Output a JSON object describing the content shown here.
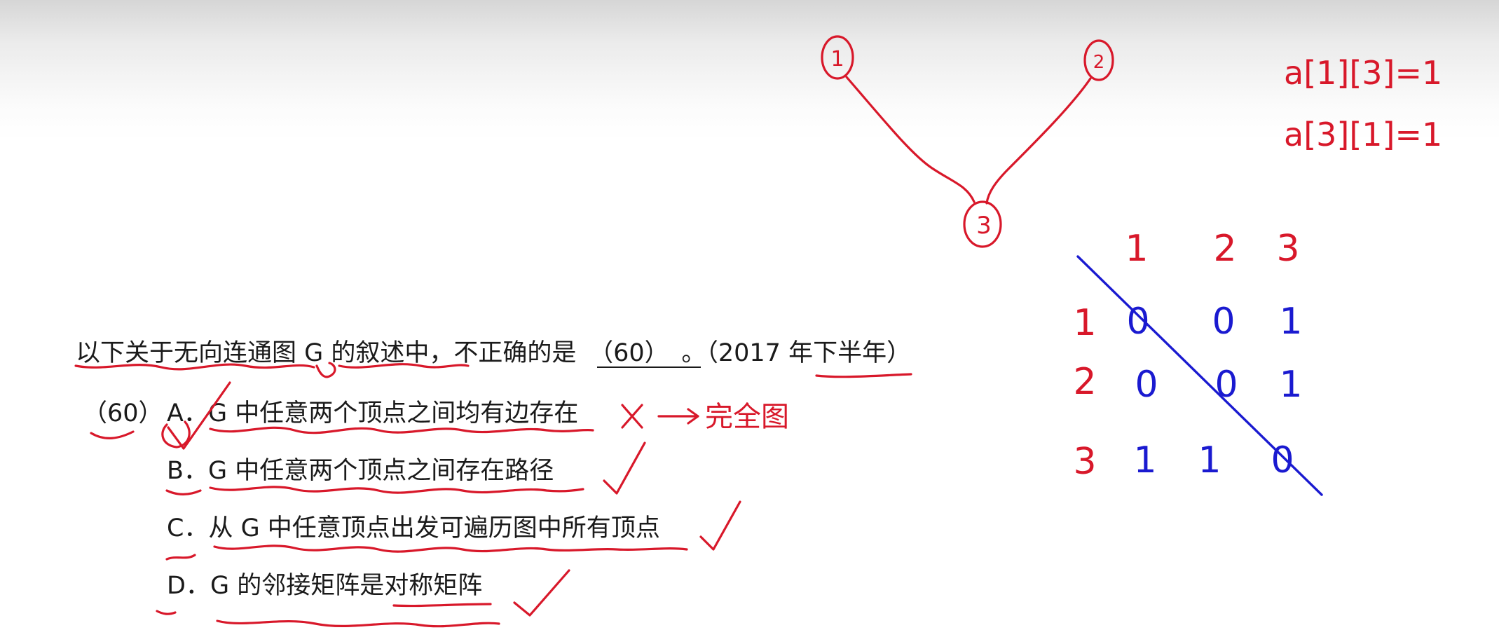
{
  "question": {
    "text": "以下关于无向连通图 G 的叙述中，不正确的是",
    "blank": "（60）",
    "suffix": "。（2017 年下半年）"
  },
  "options": {
    "number": "（60）",
    "items": [
      {
        "letter": "A",
        "text": "A．G 中任意两个顶点之间均有边存在"
      },
      {
        "letter": "B",
        "text": "B．G 中任意两个顶点之间存在路径"
      },
      {
        "letter": "C",
        "text": "C．从 G 中任意顶点出发可遍历图中所有顶点"
      },
      {
        "letter": "D",
        "text": "D．G 的邻接矩阵是对称矩阵"
      }
    ]
  },
  "handwriting": {
    "graph_nodes": [
      "1",
      "2",
      "3"
    ],
    "note_a": "完全图",
    "matrix_entries": [
      "a[1][3]=1",
      "a[3][1]=1"
    ],
    "matrix_headers": [
      "1",
      "2",
      "3"
    ],
    "matrix_rows": [
      {
        "label": "1",
        "values": [
          "0",
          "0",
          "1"
        ]
      },
      {
        "label": "2",
        "values": [
          "0",
          "0",
          "1"
        ]
      },
      {
        "label": "3",
        "values": [
          "1",
          "1",
          "0"
        ]
      }
    ],
    "ink_colors": {
      "red": "#d8182a",
      "blue": "#1a1ad0"
    }
  }
}
